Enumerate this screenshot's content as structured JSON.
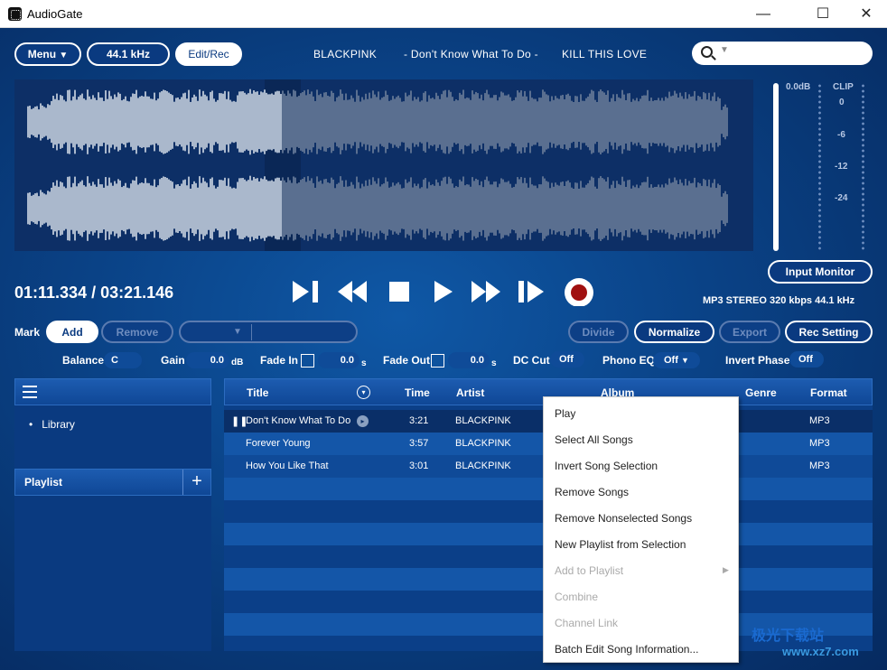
{
  "window": {
    "title": "AudioGate",
    "min": "—",
    "max": "☐",
    "close": "✕"
  },
  "toolbar": {
    "menu": "Menu",
    "menu_arrow": "▼",
    "rate": "44.1 kHz",
    "edit_rec": "Edit/Rec"
  },
  "now_playing": {
    "artist": "BLACKPINK",
    "title": "- Don't Know What To Do -",
    "album": "KILL THIS LOVE"
  },
  "search": {
    "arrow": "▼"
  },
  "meter": {
    "db": "0.0dB",
    "clip": "CLIP",
    "ticks": [
      "0",
      "-6",
      "-12",
      "-24"
    ]
  },
  "input_monitor": "Input Monitor",
  "time": {
    "current": "01:11.334",
    "separator": "/",
    "total": "03:21.146"
  },
  "format_info": "MP3 STEREO 320 kbps 44.1 kHz",
  "mark": {
    "label": "Mark",
    "add": "Add",
    "remove": "Remove",
    "dropdown_arrow": "▼"
  },
  "edit_buttons": {
    "divide": "Divide",
    "normalize": "Normalize",
    "export": "Export",
    "rec_setting": "Rec Setting"
  },
  "params": {
    "balance_label": "Balance",
    "balance": "C",
    "gain_label": "Gain",
    "gain": "0.0",
    "gain_unit": "dB",
    "fade_in_label": "Fade In",
    "fade_in": "0.0",
    "fade_in_unit": "s",
    "fade_out_label": "Fade Out",
    "fade_out": "0.0",
    "fade_out_unit": "s",
    "dc_cut_label": "DC Cut",
    "dc_cut": "Off",
    "phono_eq_label": "Phono EQ",
    "phono_eq": "Off",
    "phono_arrow": "▼",
    "invert_label": "Invert Phase",
    "invert": "Off"
  },
  "sidebar": {
    "library": "Library",
    "playlist": "Playlist",
    "add": "+"
  },
  "table": {
    "headers": {
      "title": "Title",
      "time": "Time",
      "artist": "Artist",
      "album": "Album",
      "genre": "Genre",
      "format": "Format"
    },
    "rows": [
      {
        "title": "Don't Know What To Do",
        "time": "3:21",
        "artist": "BLACKPINK",
        "format": "MP3"
      },
      {
        "title": "Forever Young",
        "time": "3:57",
        "artist": "BLACKPINK",
        "format": "MP3"
      },
      {
        "title": "How You Like That",
        "time": "3:01",
        "artist": "BLACKPINK",
        "format": "MP3"
      }
    ]
  },
  "context_menu": [
    {
      "label": "Play",
      "enabled": true
    },
    {
      "label": "Select All Songs",
      "enabled": true
    },
    {
      "label": "Invert Song Selection",
      "enabled": true
    },
    {
      "label": "Remove Songs",
      "enabled": true
    },
    {
      "label": "Remove Nonselected Songs",
      "enabled": true
    },
    {
      "label": "New Playlist from Selection",
      "enabled": true
    },
    {
      "label": "Add to Playlist",
      "enabled": false,
      "arrow": "▶"
    },
    {
      "label": "Combine",
      "enabled": false
    },
    {
      "label": "Channel Link",
      "enabled": false
    },
    {
      "label": "Batch Edit Song Information...",
      "enabled": true
    }
  ],
  "watermark": {
    "line1": "极光下载站",
    "line2": "www.xz7.com"
  },
  "colors": {
    "accent": "#0a4286",
    "waveform_played": "#aab8cc",
    "waveform_unplayed": "#5a6f90",
    "record": "#a01010"
  }
}
